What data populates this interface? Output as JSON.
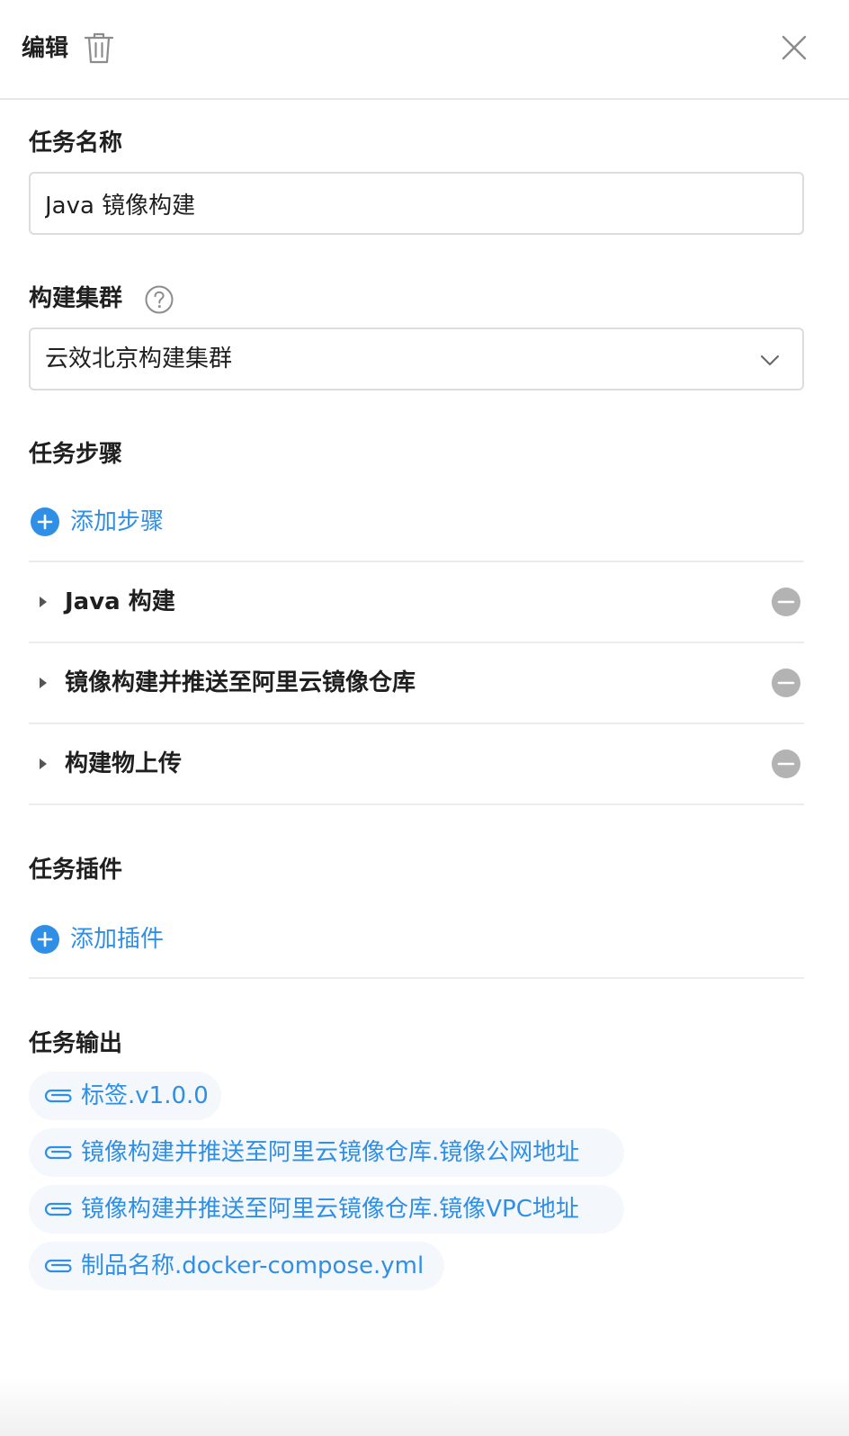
{
  "header": {
    "title": "编辑"
  },
  "task_name": {
    "label": "任务名称",
    "value": "Java 镜像构建"
  },
  "cluster": {
    "label": "构建集群",
    "selected": "云效北京构建集群"
  },
  "steps": {
    "label": "任务步骤",
    "add_label": "添加步骤",
    "items": [
      {
        "name": "Java 构建"
      },
      {
        "name": "镜像构建并推送至阿里云镜像仓库"
      },
      {
        "name": "构建物上传"
      }
    ]
  },
  "plugins": {
    "label": "任务插件",
    "add_label": "添加插件"
  },
  "outputs": {
    "label": "任务输出",
    "items": [
      {
        "label": "标签.v1.0.0"
      },
      {
        "label": "镜像构建并推送至阿里云镜像仓库.镜像公网地址"
      },
      {
        "label": "镜像构建并推送至阿里云镜像仓库.镜像VPC地址"
      },
      {
        "label": "制品名称.docker-compose.yml"
      }
    ]
  },
  "colors": {
    "accent": "#2f8fe6",
    "chip_background": "#f4f8fc",
    "remove_icon": "#b3b3b3",
    "border": "#dcdcdc"
  },
  "icons": {
    "delete": "trash-icon",
    "close": "close-icon",
    "help": "help-icon",
    "dropdown": "chevron-down-icon",
    "add": "plus-circle-icon",
    "expand": "caret-right-icon",
    "remove": "minus-circle-icon",
    "output": "paperclip-icon"
  }
}
